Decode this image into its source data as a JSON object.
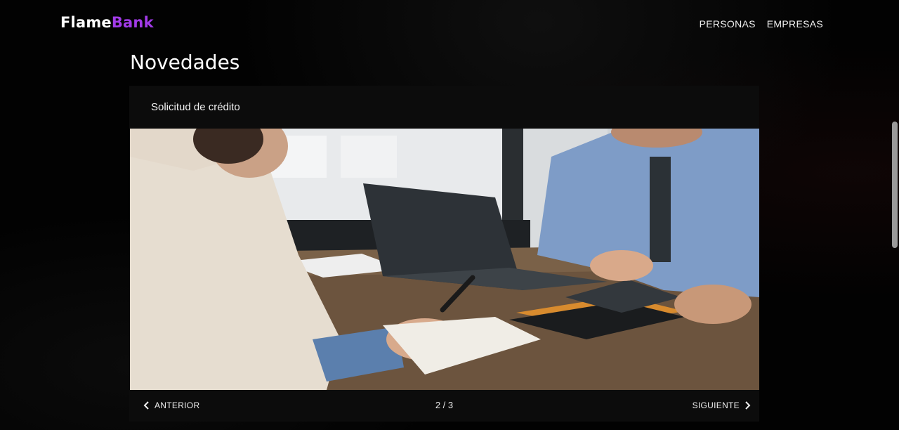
{
  "brand": {
    "name_part1": "Flame",
    "name_part2": "Bank"
  },
  "nav": {
    "items": [
      "PERSONAS",
      "EMPRESAS"
    ]
  },
  "page": {
    "title": "Novedades"
  },
  "carousel": {
    "slide_title": "Solicitud de crédito",
    "prev_label": "ANTERIOR",
    "next_label": "SIGUIENTE",
    "counter": "2 / 3",
    "current_slide": 2,
    "total_slides": 3
  },
  "colors": {
    "brand_accent": "#a23be8",
    "background": "#000000",
    "card": "#0c0c0c"
  },
  "icons": {
    "prev": "chevron-left-icon",
    "next": "chevron-right-icon"
  }
}
